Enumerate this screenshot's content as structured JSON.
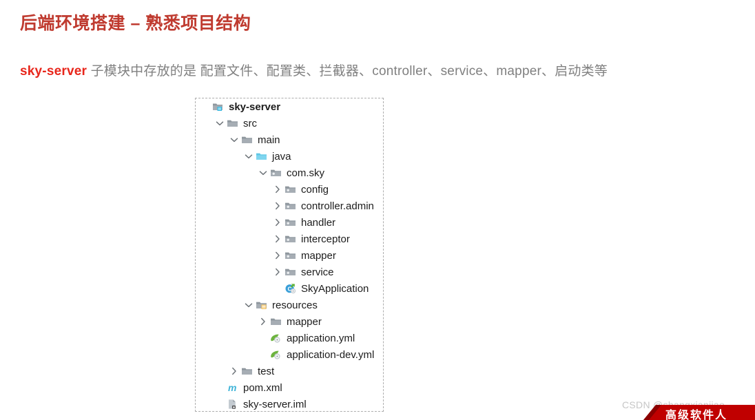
{
  "slide": {
    "title": "后端环境搭建 – 熟悉项目结构",
    "title_color": "#bf3a2f",
    "subtitle_highlight": "sky-server",
    "subtitle_rest": " 子模块中存放的是 配置文件、配置类、拦截器、controller、service、mapper、启动类等",
    "highlight_color": "#e8261b"
  },
  "tree": {
    "nodes": [
      {
        "label": "sky-server",
        "depth": 0,
        "twisty": "none",
        "icon": "module-folder-icon",
        "bold": true
      },
      {
        "label": "src",
        "depth": 1,
        "twisty": "expanded",
        "icon": "folder-icon",
        "bold": false
      },
      {
        "label": "main",
        "depth": 2,
        "twisty": "expanded",
        "icon": "folder-icon",
        "bold": false
      },
      {
        "label": "java",
        "depth": 3,
        "twisty": "expanded",
        "icon": "source-folder-icon",
        "bold": false
      },
      {
        "label": "com.sky",
        "depth": 4,
        "twisty": "expanded",
        "icon": "package-icon",
        "bold": false
      },
      {
        "label": "config",
        "depth": 5,
        "twisty": "collapsed",
        "icon": "package-icon",
        "bold": false
      },
      {
        "label": "controller.admin",
        "depth": 5,
        "twisty": "collapsed",
        "icon": "package-icon",
        "bold": false
      },
      {
        "label": "handler",
        "depth": 5,
        "twisty": "collapsed",
        "icon": "package-icon",
        "bold": false
      },
      {
        "label": "interceptor",
        "depth": 5,
        "twisty": "collapsed",
        "icon": "package-icon",
        "bold": false
      },
      {
        "label": "mapper",
        "depth": 5,
        "twisty": "collapsed",
        "icon": "package-icon",
        "bold": false
      },
      {
        "label": "service",
        "depth": 5,
        "twisty": "collapsed",
        "icon": "package-icon",
        "bold": false
      },
      {
        "label": "SkyApplication",
        "depth": 5,
        "twisty": "none",
        "icon": "runnable-class-icon",
        "bold": false
      },
      {
        "label": "resources",
        "depth": 3,
        "twisty": "expanded",
        "icon": "resource-folder-icon",
        "bold": false
      },
      {
        "label": "mapper",
        "depth": 4,
        "twisty": "collapsed",
        "icon": "folder-icon",
        "bold": false
      },
      {
        "label": "application.yml",
        "depth": 4,
        "twisty": "none",
        "icon": "spring-yml-icon",
        "bold": false
      },
      {
        "label": "application-dev.yml",
        "depth": 4,
        "twisty": "none",
        "icon": "spring-yml-icon",
        "bold": false
      },
      {
        "label": "test",
        "depth": 2,
        "twisty": "collapsed",
        "icon": "folder-icon",
        "bold": false
      },
      {
        "label": "pom.xml",
        "depth": 1,
        "twisty": "none",
        "icon": "maven-icon",
        "bold": false
      },
      {
        "label": "sky-server.iml",
        "depth": 1,
        "twisty": "none",
        "icon": "iml-icon",
        "bold": false
      }
    ]
  },
  "watermark": {
    "text": "CSDN @shangxianjiao",
    "ribbon_text": "高级软件人"
  }
}
